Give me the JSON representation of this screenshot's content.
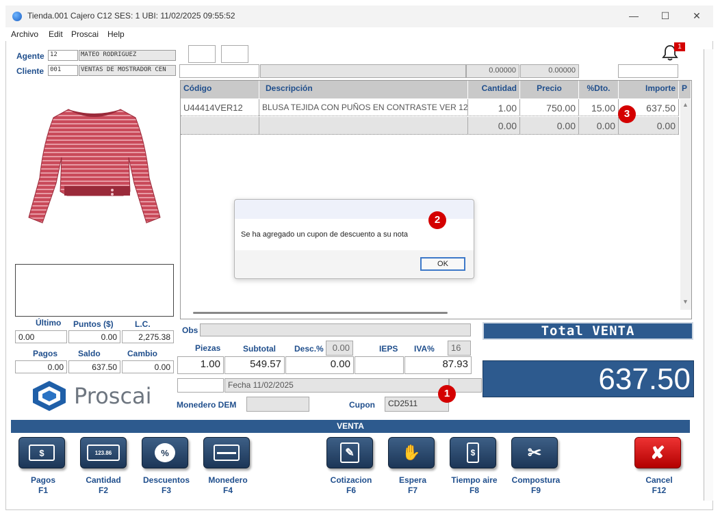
{
  "window": {
    "title": "Tienda.001  Cajero C12      SES: 1   UBI:    11/02/2025 09:55:52",
    "minimize": "—",
    "maximize": "☐",
    "close": "✕"
  },
  "menu": [
    "Archivo",
    "Edit",
    "Proscai",
    "Help"
  ],
  "agent": {
    "label": "Agente",
    "code": "12",
    "name": "MATEO RODRIGUEZ"
  },
  "client": {
    "label": "Cliente",
    "code": "001",
    "name": "VENTAS DE MOSTRADOR CEN"
  },
  "notification": {
    "count": "1"
  },
  "header_values": {
    "v1": "0.00000",
    "v2": "0.00000"
  },
  "table": {
    "headers": [
      "Código",
      "Descripción",
      "Cantidad",
      "Precio",
      "%Dto.",
      "Importe",
      "P"
    ],
    "rows": [
      {
        "code": "U44414VER12",
        "desc": "BLUSA TEJIDA CON PUÑOS EN CONTRASTE VER 12",
        "qty": "1.00",
        "price": "750.00",
        "dto": "15.00",
        "amount": "637.50"
      },
      {
        "code": "",
        "desc": "",
        "qty": "0.00",
        "price": "0.00",
        "dto": "0.00",
        "amount": "0.00"
      }
    ]
  },
  "dialog": {
    "message": "Se ha agregado un cupon de descuento a su nota",
    "ok": "OK"
  },
  "badges": {
    "b1": "1",
    "b2": "2",
    "b3": "3"
  },
  "customer_stats": {
    "labels": [
      "Último",
      "Puntos ($)",
      "L.C."
    ],
    "values": [
      "0.00",
      "0.00",
      "2,275.38"
    ],
    "labels2": [
      "Pagos",
      "Saldo",
      "Cambio"
    ],
    "values2": [
      "0.00",
      "637.50",
      "0.00"
    ]
  },
  "brand": {
    "name": "Proscai"
  },
  "obs": {
    "label": "Obs",
    "value": ""
  },
  "totals": {
    "piezas_label": "Piezas",
    "piezas": "1.00",
    "subtotal_label": "Subtotal",
    "subtotal": "549.57",
    "desc_label": "Desc.%",
    "desc_pct": "0.00",
    "desc": "0.00",
    "ieps_label": "IEPS",
    "iva_label": "IVA%",
    "iva_pct": "16",
    "iva": "87.93"
  },
  "fecha": "Fecha 11/02/2025",
  "monedero": {
    "label": "Monedero DEM",
    "value": ""
  },
  "cupon": {
    "label": "Cupon",
    "value": "CD2511"
  },
  "total": {
    "label": "Total VENTA",
    "value": "637.50"
  },
  "venta_bar": "VENTA",
  "fkeys": [
    {
      "label": "Pagos",
      "key": "F1",
      "icon": "$"
    },
    {
      "label": "Cantidad",
      "key": "F2",
      "icon": "123.86"
    },
    {
      "label": "Descuentos",
      "key": "F3",
      "icon": "%"
    },
    {
      "label": "Monedero",
      "key": "F4",
      "icon": ""
    },
    {
      "label": "Cotizacion",
      "key": "F6",
      "icon": "✎"
    },
    {
      "label": "Espera",
      "key": "F7",
      "icon": "✋"
    },
    {
      "label": "Tiempo aire",
      "key": "F8",
      "icon": "$"
    },
    {
      "label": "Compostura",
      "key": "F9",
      "icon": "✂"
    },
    {
      "label": "Cancel",
      "key": "F12",
      "icon": "✘"
    }
  ],
  "colors": {
    "accent": "#1f4e8c",
    "badge": "#d40000",
    "total_bg": "#2d5a8e"
  }
}
